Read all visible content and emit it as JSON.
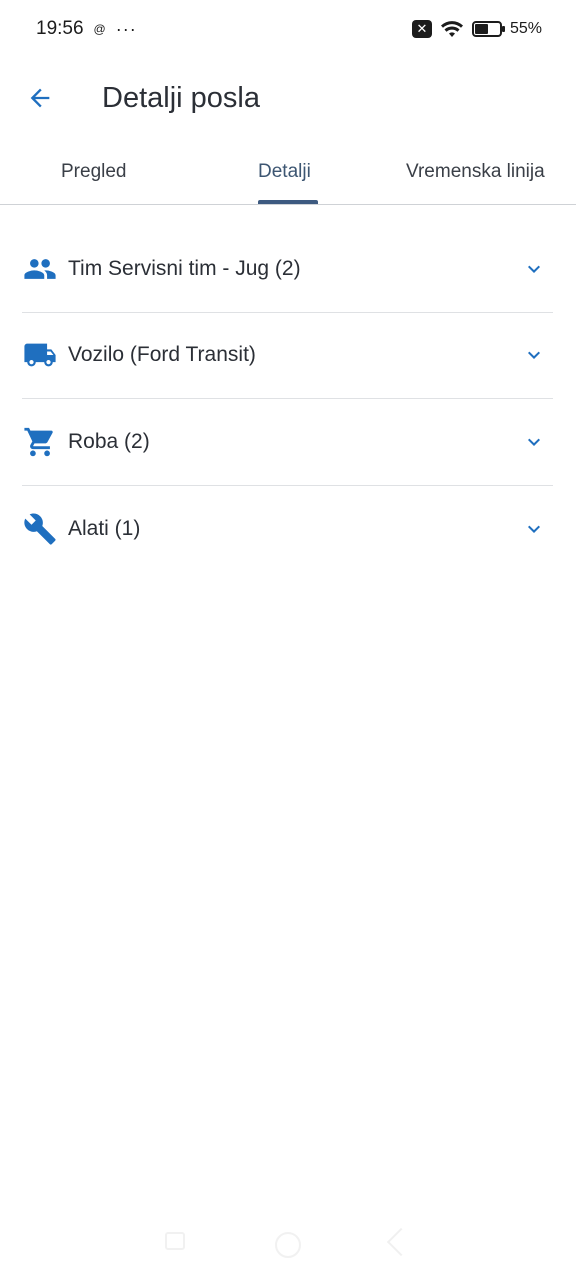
{
  "status_bar": {
    "time": "19:56",
    "notif_icon": "@",
    "more_dots": "···",
    "battery_percent": "55%",
    "battery_level": 0.55
  },
  "app_bar": {
    "back_icon": "arrow-left-icon",
    "title": "Detalji posla"
  },
  "tabs": [
    {
      "label": "Pregled",
      "active": false
    },
    {
      "label": "Detalji",
      "active": true
    },
    {
      "label": "Vremenska linija",
      "active": false
    }
  ],
  "sections": [
    {
      "icon": "group-icon",
      "label": "Tim Servisni tim - Jug (2)"
    },
    {
      "icon": "truck-icon",
      "label": "Vozilo (Ford Transit)"
    },
    {
      "icon": "cart-icon",
      "label": "Roba (2)"
    },
    {
      "icon": "wrench-icon",
      "label": "Alati (1)"
    }
  ],
  "colors": {
    "accent": "#1f6fbf",
    "tab_indicator": "#3d5a80",
    "text": "#2b2f36",
    "divider": "#dfe1e4"
  }
}
